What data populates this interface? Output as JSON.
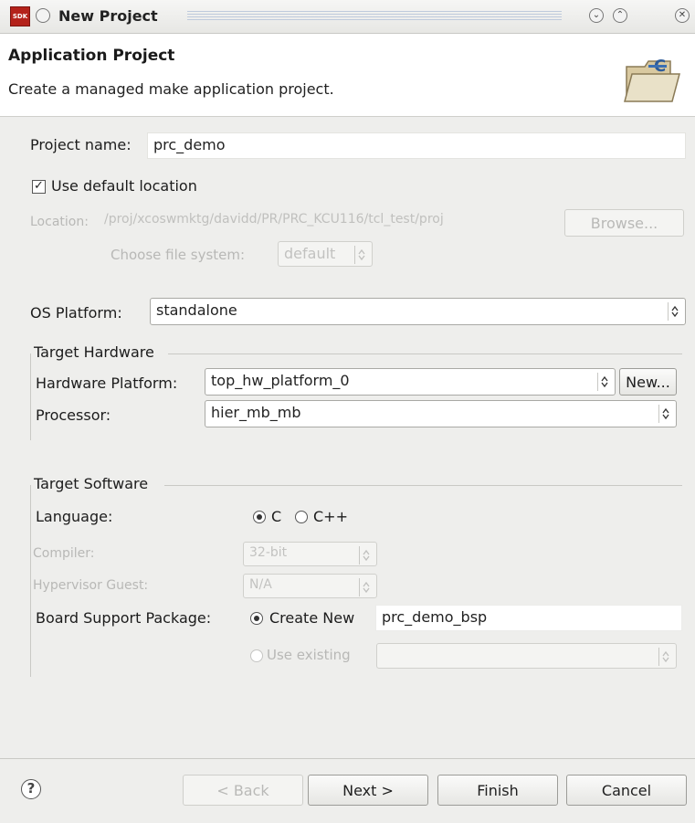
{
  "window": {
    "title": "New Project",
    "app_icon_text": "SDK"
  },
  "banner": {
    "title": "Application Project",
    "description": "Create a managed make application project."
  },
  "project": {
    "name_label": "Project name:",
    "name_value": "prc_demo",
    "use_default_label": "Use default location",
    "use_default_checked": true,
    "location_label": "Location:",
    "location_value": "/proj/xcoswmktg/davidd/PR/PRC_KCU116/tcl_test/proj",
    "browse_label": "Browse...",
    "filesystem_label": "Choose file system:",
    "filesystem_value": "default"
  },
  "os": {
    "label": "OS Platform:",
    "value": "standalone"
  },
  "target_hardware": {
    "group_label": "Target Hardware",
    "platform_label": "Hardware Platform:",
    "platform_value": "top_hw_platform_0",
    "new_button": "New...",
    "processor_label": "Processor:",
    "processor_value": "hier_mb_mb"
  },
  "target_software": {
    "group_label": "Target Software",
    "language_label": "Language:",
    "lang_c": "C",
    "lang_cpp": "C++",
    "compiler_label": "Compiler:",
    "compiler_value": "32-bit",
    "hypervisor_label": "Hypervisor Guest:",
    "hypervisor_value": "N/A",
    "bsp_label": "Board Support Package:",
    "bsp_create_new": "Create New",
    "bsp_name": "prc_demo_bsp",
    "bsp_use_existing": "Use existing"
  },
  "buttons": {
    "back": "< Back",
    "next": "Next >",
    "finish": "Finish",
    "cancel": "Cancel",
    "help": "?"
  },
  "colors": {
    "window_bg": "#eeeeec",
    "app_icon_red": "#b4221b"
  }
}
